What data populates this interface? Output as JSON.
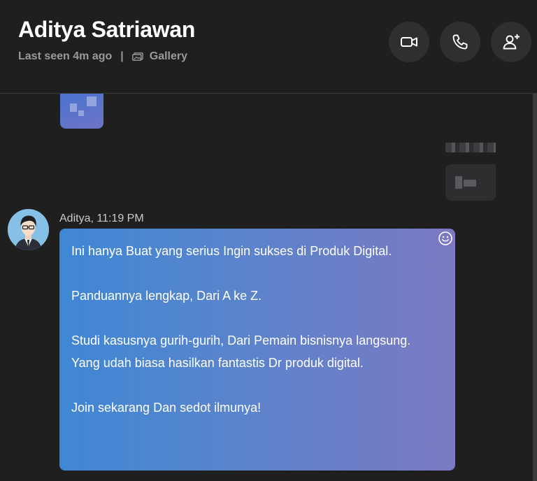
{
  "header": {
    "title": "Aditya Satriawan",
    "last_seen": "Last seen 4m ago",
    "separator": "|",
    "gallery_label": "Gallery",
    "buttons": [
      "video-call-icon",
      "voice-call-icon",
      "add-person-icon"
    ]
  },
  "messages": {
    "incoming": {
      "sender_meta": "Aditya, 11:19 PM",
      "paragraphs": [
        "Ini hanya Buat yang serius Ingin sukses di Produk Digital.",
        "Panduannya lengkap, Dari A ke Z.",
        "Studi kasusnya gurih-gurih, Dari Pemain bisnisnya langsung. Yang udah biasa hasilkan fantastis Dr produk digital.",
        "Join sekarang Dan sedot ilmunya!"
      ]
    }
  },
  "colors": {
    "background": "#1f1f20",
    "bubble_start": "#3f87d4",
    "bubble_end": "#7b79c2",
    "muted_text": "#9a9a9e"
  }
}
